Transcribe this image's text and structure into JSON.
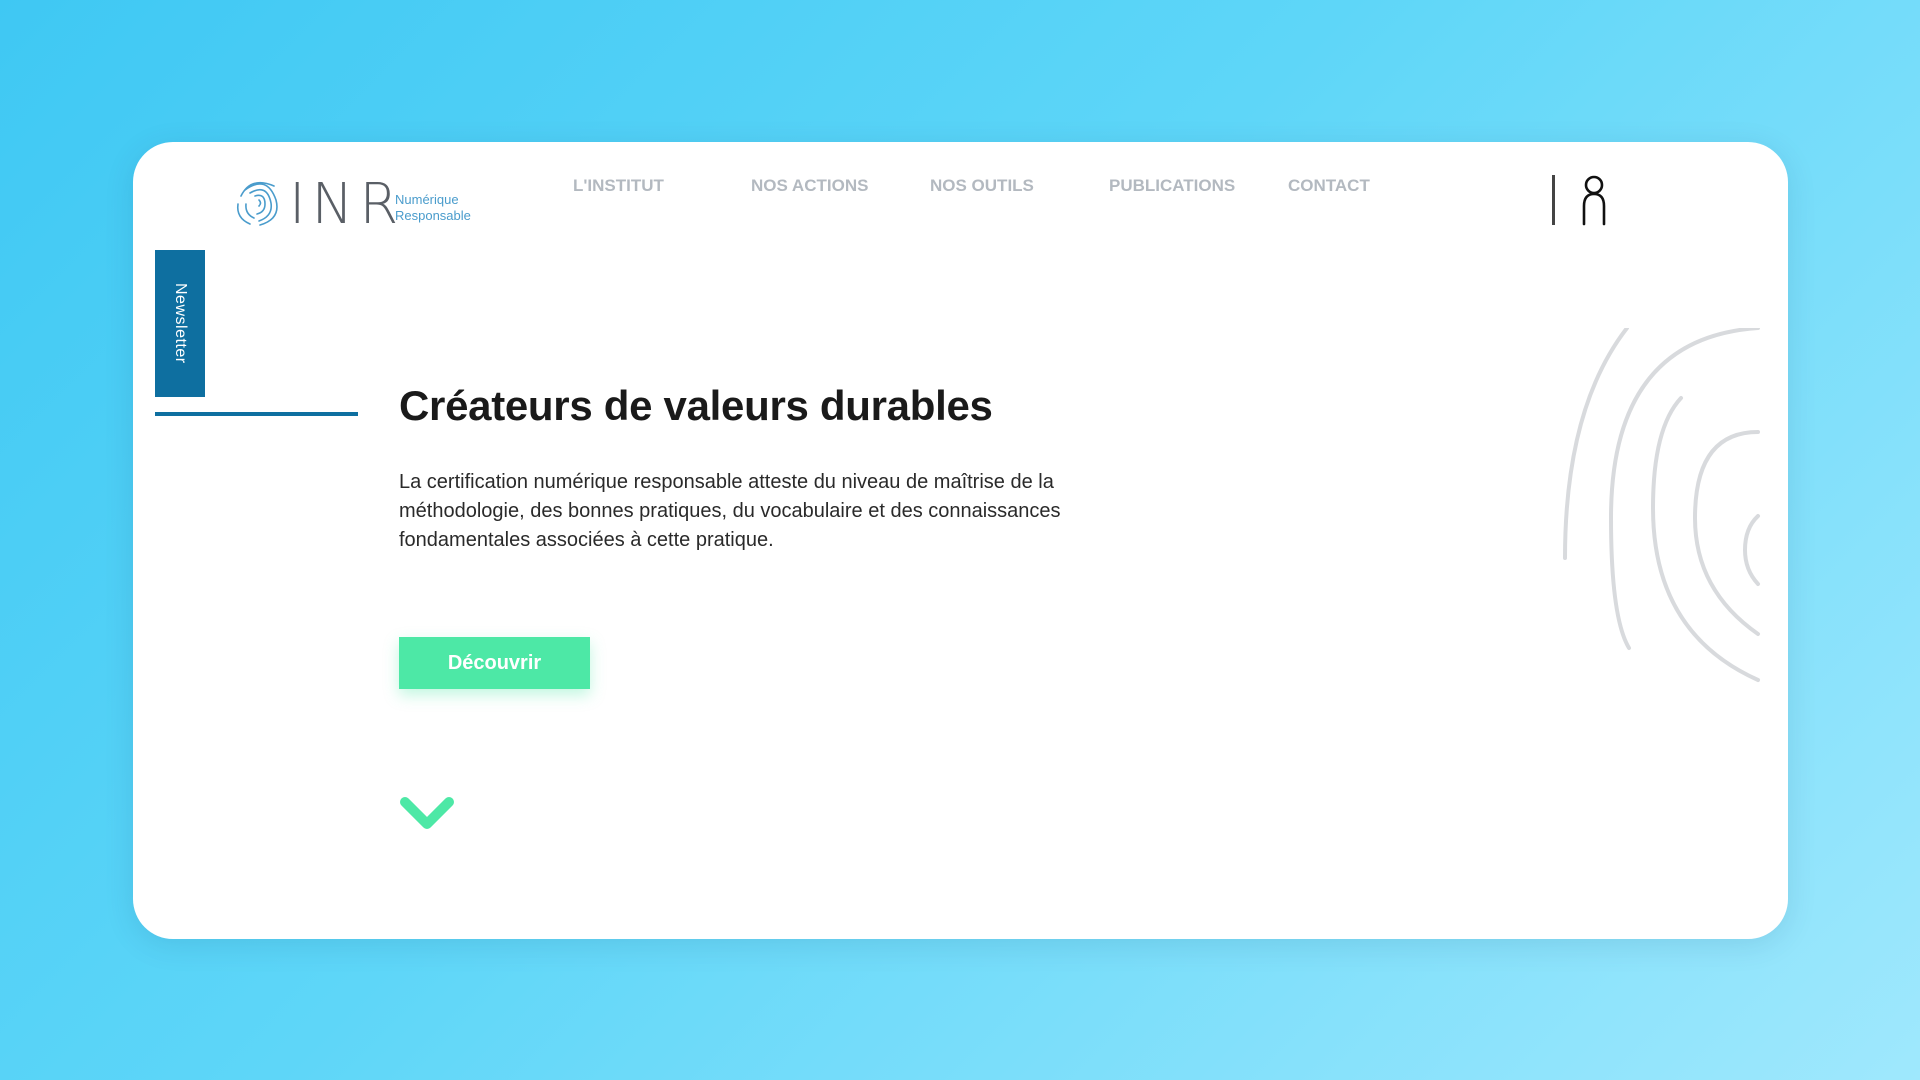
{
  "logo": {
    "letters": "INR",
    "subtitle_line1": "Numérique",
    "subtitle_line2": "Responsable"
  },
  "nav": {
    "items": [
      {
        "label": "L'INSTITUT"
      },
      {
        "label": "NOS ACTIONS"
      },
      {
        "label": "NOS OUTILS"
      },
      {
        "label": "PUBLICATIONS"
      },
      {
        "label": "CONTACT"
      }
    ]
  },
  "sidebar": {
    "newsletter_label": "Newsletter"
  },
  "hero": {
    "title": "Créateurs de valeurs durables",
    "description": "La certification numérique responsable atteste du niveau de maîtrise de la méthodologie, des bonnes pratiques, du vocabulaire et des connaissances fondamentales associées à cette pratique.",
    "cta_label": "Découvrir"
  },
  "icons": {
    "logo": "fingerprint-icon",
    "account": "user-icon",
    "scroll": "chevron-down-icon",
    "decoration": "fingerprint-decoration"
  },
  "colors": {
    "primary_blue": "#0e6fa0",
    "accent_green": "#4de8a6",
    "logo_blue": "#4a9ccc",
    "nav_grey": "#b3b9c0"
  }
}
